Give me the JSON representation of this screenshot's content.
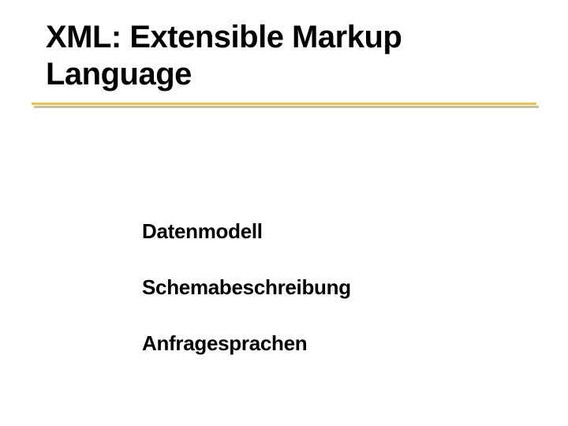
{
  "slide": {
    "title_line1": "XML: Extensible Markup",
    "title_line2": "Language",
    "items": [
      "Datenmodell",
      "Schemabeschreibung",
      "Anfragesprachen"
    ]
  },
  "colors": {
    "rule_main": "#e6c84f",
    "rule_shadow": "#9a8b5a"
  }
}
